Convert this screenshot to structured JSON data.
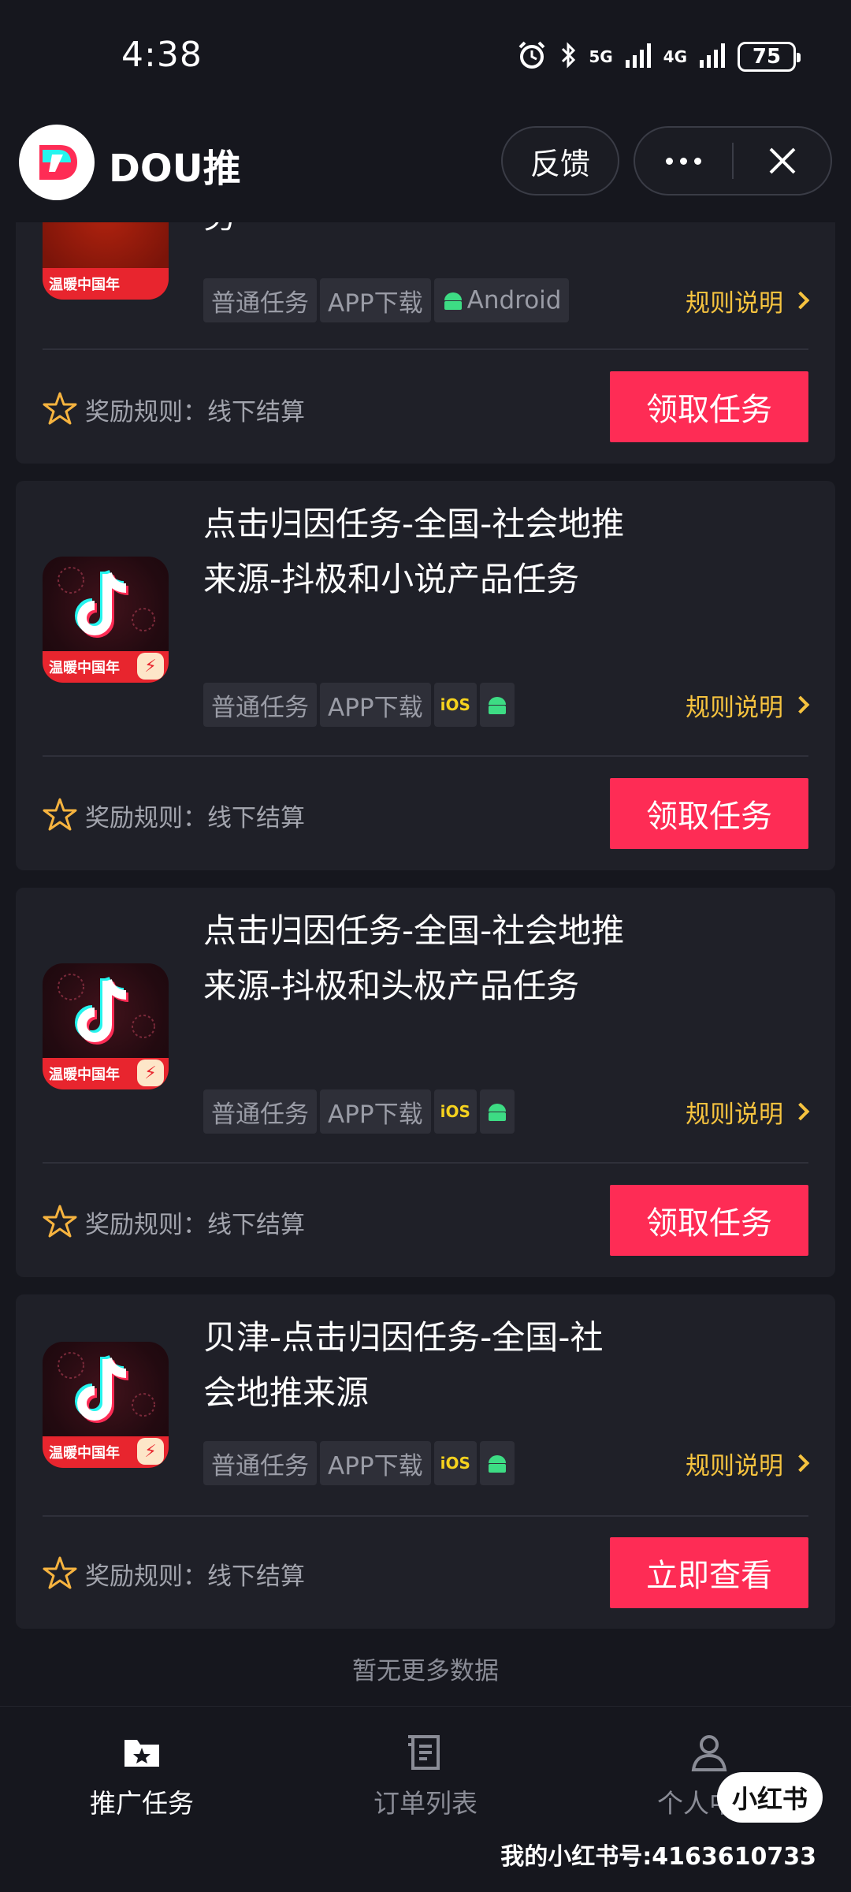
{
  "status_bar": {
    "time": "4:38",
    "network_5g": "5G",
    "network_4g": "4G",
    "battery": "75"
  },
  "header": {
    "title": "DOU推",
    "feedback_label": "反馈"
  },
  "cards": [
    {
      "title": "务",
      "thumb_label": "温暖中国年",
      "tags": [
        "普通任务",
        "APP下载"
      ],
      "android_label": "Android",
      "rule_link": "规则说明",
      "reward": "奖励规则：线下结算",
      "action": "领取任务"
    },
    {
      "title": "点击归因任务-全国-社会地推来源-抖极和小说产品任务",
      "thumb_label": "温暖中国年",
      "tags": [
        "普通任务",
        "APP下载"
      ],
      "ios_label": "iOS",
      "rule_link": "规则说明",
      "reward": "奖励规则：线下结算",
      "action": "领取任务"
    },
    {
      "title": "点击归因任务-全国-社会地推来源-抖极和头极产品任务",
      "thumb_label": "温暖中国年",
      "tags": [
        "普通任务",
        "APP下载"
      ],
      "ios_label": "iOS",
      "rule_link": "规则说明",
      "reward": "奖励规则：线下结算",
      "action": "领取任务"
    },
    {
      "title": "贝津-点击归因任务-全国-社会地推来源",
      "thumb_label": "温暖中国年",
      "tags": [
        "普通任务",
        "APP下载"
      ],
      "ios_label": "iOS",
      "rule_link": "规则说明",
      "reward": "奖励规则：线下结算",
      "action": "立即查看"
    }
  ],
  "list_footer": "暂无更多数据",
  "bottom_nav": [
    {
      "label": "推广任务",
      "icon": "folder-star-icon",
      "active": true
    },
    {
      "label": "订单列表",
      "icon": "order-list-icon",
      "active": false
    },
    {
      "label": "个人中心",
      "icon": "person-icon",
      "active": false
    }
  ],
  "watermark": {
    "badge": "小红书",
    "text": "我的小红书号:4163610733"
  },
  "colors": {
    "background": "#16171e",
    "card": "#1f2028",
    "accent_button": "#fe2c55",
    "rule_link": "#f6c33f",
    "tag_bg": "#2e2f38",
    "android_green": "#3ddc84",
    "ios_yellow": "#f5d21e"
  }
}
